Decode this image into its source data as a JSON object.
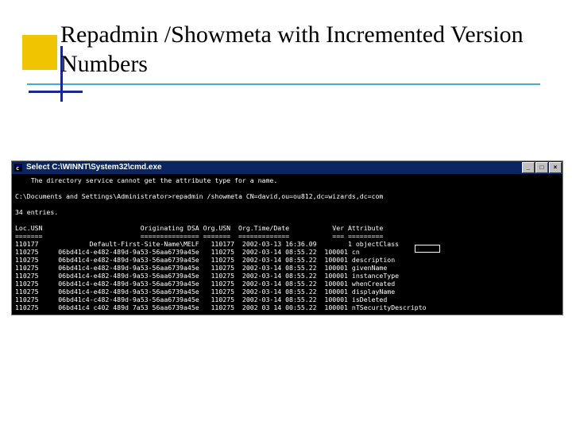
{
  "slide": {
    "title": "Repadmin /Showmeta with  Incremented Version Numbers"
  },
  "console": {
    "window_title": "Select C:\\WINNT\\System32\\cmd.exe",
    "error_line": "The directory service cannot get the attribute type for a name.",
    "prompt": "C:\\Documents and Settings\\Administrator>",
    "command": "repadmin /showmeta CN=david,ou=ou812,dc=wizards,dc=com",
    "count_line": "34 entries.",
    "header": {
      "loc_usn": "Loc.USN",
      "orig_dsa": "Originating DSA",
      "org_usn": "Org.USN",
      "org_time": "Org.Time/Date",
      "ver": "Ver",
      "attr": "Attribute"
    },
    "header_rule": {
      "loc_usn": "=======",
      "orig_dsa": "===============",
      "org_usn": "=======",
      "org_time": "=============",
      "ver": "===",
      "attr": "========="
    },
    "rows": [
      {
        "loc": "110177",
        "dsa": "         Default-First-Site-Name\\MELF",
        "usn": "110177",
        "dt": "2002-03-13 16:36.09",
        "ver": "      1",
        "attr": "objectClass"
      },
      {
        "loc": "110275",
        "dsa": "06bd41c4-e482-489d-9a53-56aa6739a45e",
        "usn": "110275",
        "dt": "2002-03-14 08:55.22",
        "ver": "100001",
        "attr": "cn"
      },
      {
        "loc": "110275",
        "dsa": "06bd41c4-e482-489d-9a53-56aa6739a45e",
        "usn": "110275",
        "dt": "2002-03-14 08:55.22",
        "ver": "100001",
        "attr": "description"
      },
      {
        "loc": "110275",
        "dsa": "06bd41c4-e482-489d-9a53-56aa6739a45e",
        "usn": "110275",
        "dt": "2002-03-14 08:55.22",
        "ver": "100001",
        "attr": "givenName"
      },
      {
        "loc": "110275",
        "dsa": "06bd41c4-e482-489d-9a53-56aa6739a45e",
        "usn": "110275",
        "dt": "2002-03-14 08:55.22",
        "ver": "100001",
        "attr": "instanceType"
      },
      {
        "loc": "110275",
        "dsa": "06bd41c4-e482-489d-9a53-56aa6739a45e",
        "usn": "110275",
        "dt": "2002-03-14 08:55.22",
        "ver": "100001",
        "attr": "whenCreated"
      },
      {
        "loc": "110275",
        "dsa": "06bd41c4-e482-489d-9a53-56aa6739a45e",
        "usn": "110275",
        "dt": "2002-03-14 08:55.22",
        "ver": "100001",
        "attr": "displayName"
      },
      {
        "loc": "110275",
        "dsa": "06bd41c4-c482-489d-9a53-56aa6739a45e",
        "usn": "110275",
        "dt": "2002-03-14 08:55.22",
        "ver": "100001",
        "attr": "isDeleted"
      },
      {
        "loc": "110275",
        "dsa": "06bd41c4 c402 489d 7a53 56aa6739a45e",
        "usn": "110275",
        "dt": "2002 03 14 00:55.22",
        "ver": "100001",
        "attr": "nTSecurityDescripto"
      }
    ]
  }
}
